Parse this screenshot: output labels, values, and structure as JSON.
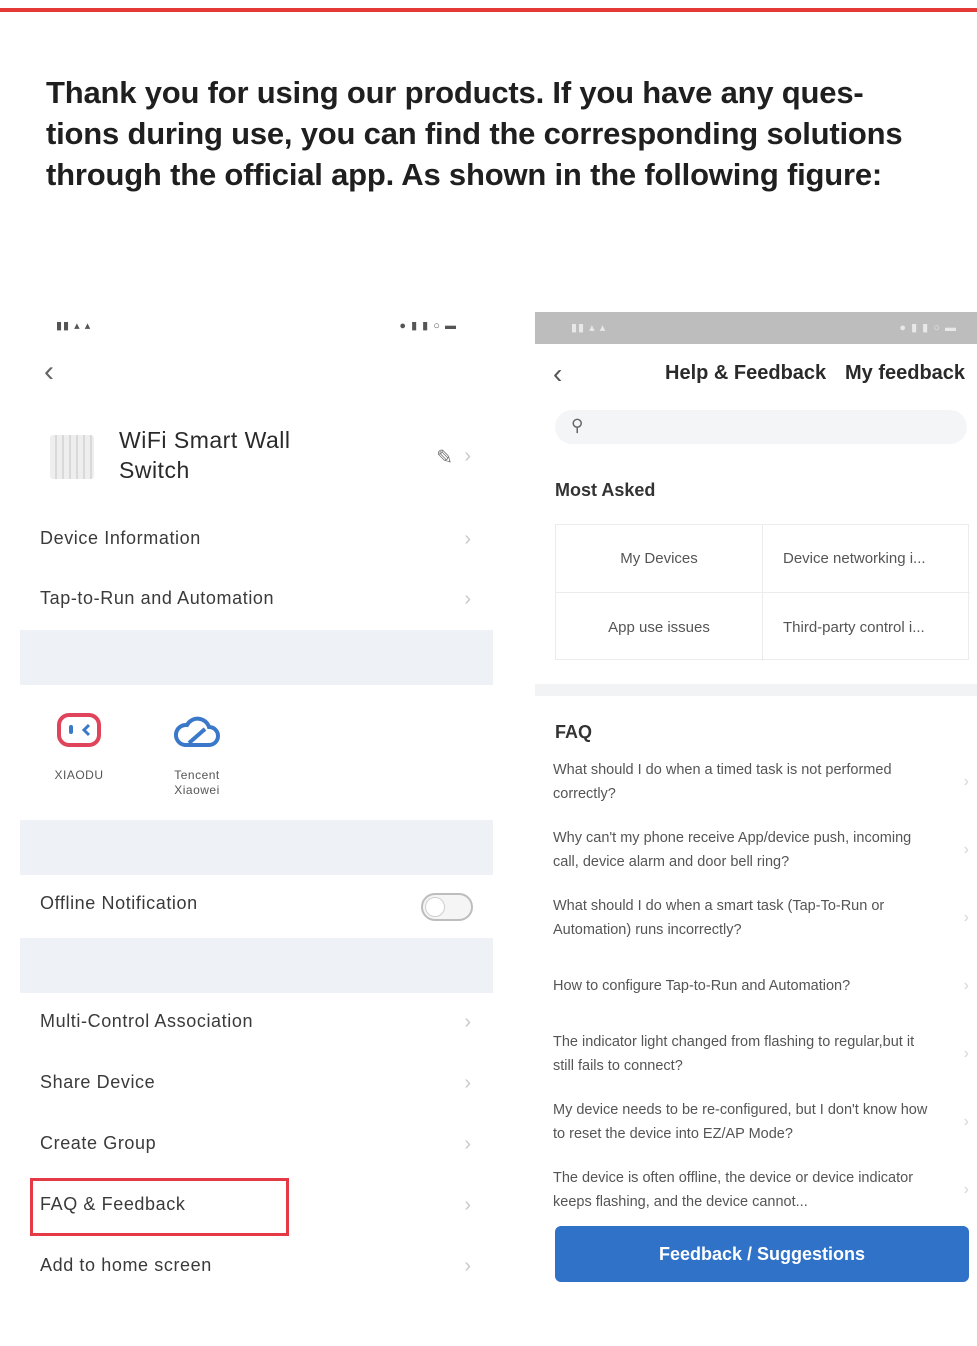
{
  "intro": {
    "line1": "Thank you for using our products. If you have any ques-",
    "line2": "tions during use, you can find the corresponding solutions",
    "line3": "through the official app. As shown in the following figure:"
  },
  "accent_red": "#e53935",
  "left_screen": {
    "back_icon": "chevron-left-icon",
    "device_name": "WiFi Smart Wall Switch",
    "edit_icon": "pencil-icon",
    "rows_top": [
      {
        "label": "Device Information"
      },
      {
        "label": "Tap-to-Run and Automation"
      }
    ],
    "third_party": {
      "items": [
        {
          "name": "XIAODU",
          "icon": "xiaodu-icon"
        },
        {
          "name": "Tencent Xiaowei",
          "icon": "cloud-icon"
        }
      ]
    },
    "offline": {
      "label": "Offline Notification",
      "toggle_on": false
    },
    "others_rows": [
      {
        "label": "Multi-Control Association"
      },
      {
        "label": "Share Device"
      },
      {
        "label": "Create Group"
      },
      {
        "label": "FAQ & Feedback"
      },
      {
        "label": "Add to home screen"
      }
    ],
    "highlighted_row": "FAQ & Feedback"
  },
  "right_screen": {
    "back_icon": "chevron-left-icon",
    "title": "Help & Feedback",
    "my_feedback": "My feedback",
    "search_icon": "search-icon",
    "most_asked_heading": "Most Asked",
    "most_asked": [
      [
        "My Devices",
        "Device networking i..."
      ],
      [
        "App use issues",
        "Third-party control i..."
      ]
    ],
    "faq_heading": "FAQ",
    "faq": [
      "What should I do when a timed task is not performed correctly?",
      "Why can't my phone receive App/device push, incoming call, device alarm and door bell ring?",
      "What should I do when a smart task (Tap-To-Run or Automation) runs incorrectly?",
      "How to configure Tap-to-Run and Automation?",
      "The indicator light changed from flashing to regular,but it still fails to connect?",
      "My device needs to be re-configured, but I don't know how to reset the device into EZ/AP Mode?",
      "The device is often offline, the device or device indicator keeps flashing, and the device cannot..."
    ],
    "feedback_button": "Feedback / Suggestions",
    "accent_blue": "#2f72c8"
  }
}
